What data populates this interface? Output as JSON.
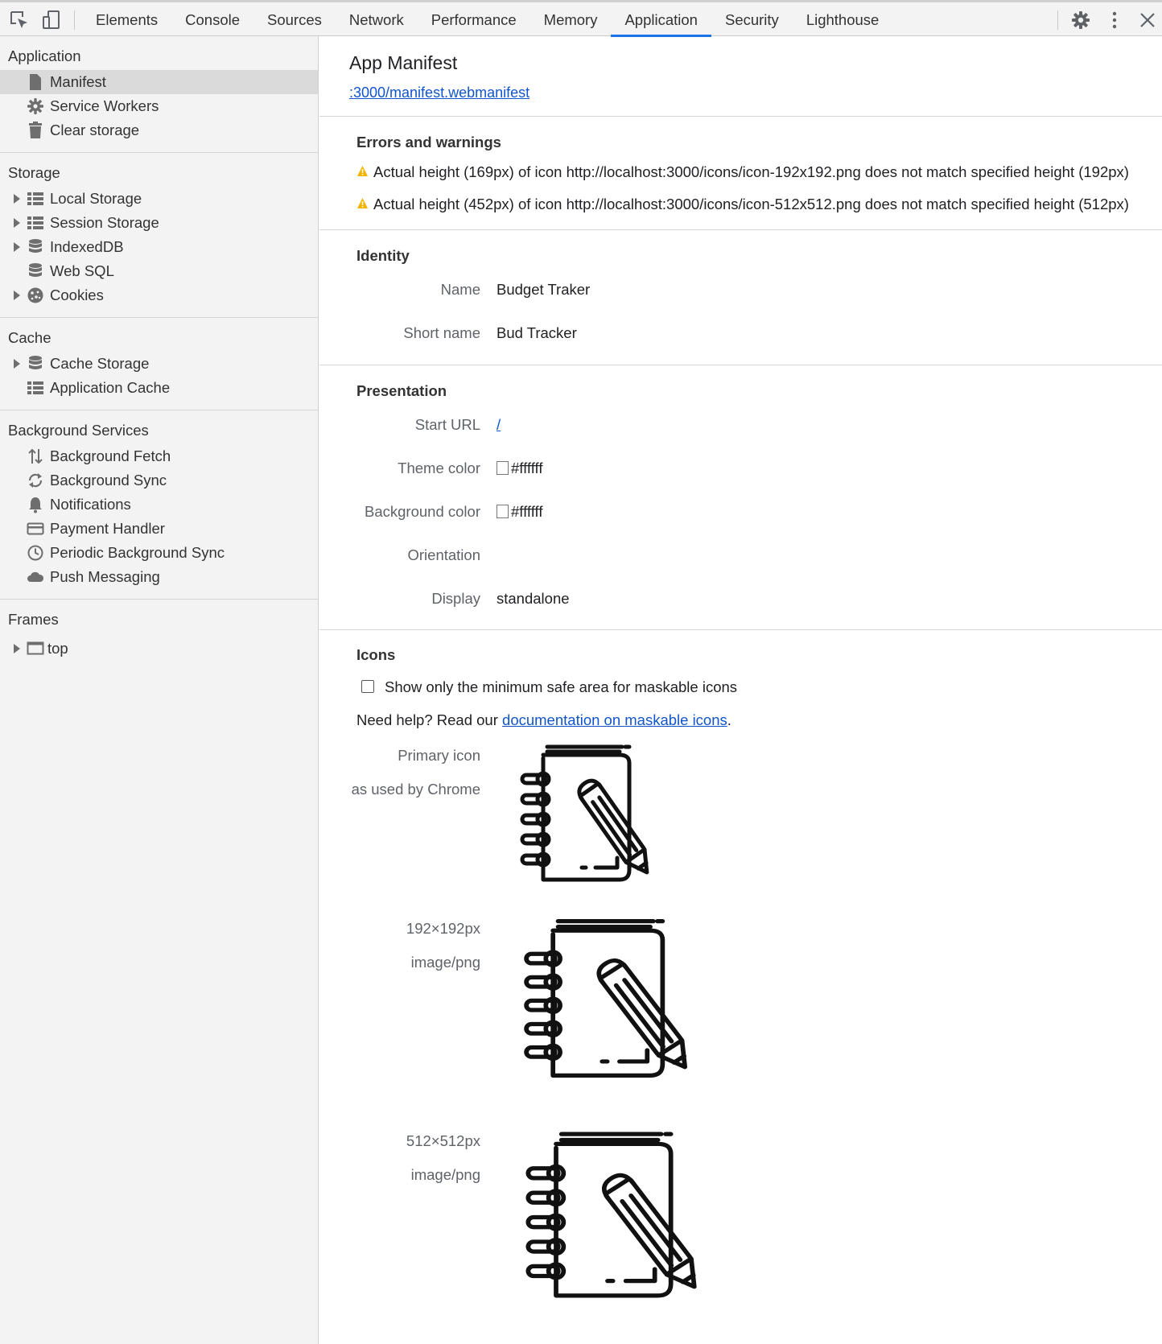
{
  "toolbar": {
    "tabs": [
      "Elements",
      "Console",
      "Sources",
      "Network",
      "Performance",
      "Memory",
      "Application",
      "Security",
      "Lighthouse"
    ],
    "active_tab": "Application"
  },
  "sidebar": {
    "application": {
      "heading": "Application",
      "items": [
        {
          "label": "Manifest",
          "icon": "document-icon"
        },
        {
          "label": "Service Workers",
          "icon": "gear-icon"
        },
        {
          "label": "Clear storage",
          "icon": "trash-icon"
        }
      ]
    },
    "storage": {
      "heading": "Storage",
      "items": [
        {
          "label": "Local Storage",
          "icon": "grid-icon"
        },
        {
          "label": "Session Storage",
          "icon": "grid-icon"
        },
        {
          "label": "IndexedDB",
          "icon": "database-icon"
        },
        {
          "label": "Web SQL",
          "icon": "database-icon"
        },
        {
          "label": "Cookies",
          "icon": "cookie-icon"
        }
      ]
    },
    "cache": {
      "heading": "Cache",
      "items": [
        {
          "label": "Cache Storage",
          "icon": "database-icon"
        },
        {
          "label": "Application Cache",
          "icon": "grid-icon"
        }
      ]
    },
    "background": {
      "heading": "Background Services",
      "items": [
        {
          "label": "Background Fetch",
          "icon": "arrows-updown-icon"
        },
        {
          "label": "Background Sync",
          "icon": "sync-icon"
        },
        {
          "label": "Notifications",
          "icon": "bell-icon"
        },
        {
          "label": "Payment Handler",
          "icon": "card-icon"
        },
        {
          "label": "Periodic Background Sync",
          "icon": "clock-icon"
        },
        {
          "label": "Push Messaging",
          "icon": "cloud-icon"
        }
      ]
    },
    "frames": {
      "heading": "Frames",
      "items": [
        {
          "label": "top",
          "icon": "frame-icon"
        }
      ]
    }
  },
  "main": {
    "title": "App Manifest",
    "manifest_link": ":3000/manifest.webmanifest",
    "errors": {
      "title": "Errors and warnings",
      "warnings": [
        "Actual height (169px) of icon http://localhost:3000/icons/icon-192x192.png does not match specified height (192px)",
        "Actual height (452px) of icon http://localhost:3000/icons/icon-512x512.png does not match specified height (512px)"
      ]
    },
    "identity": {
      "title": "Identity",
      "name_label": "Name",
      "name_value": "Budget Traker",
      "short_name_label": "Short name",
      "short_name_value": "Bud Tracker"
    },
    "presentation": {
      "title": "Presentation",
      "start_url_label": "Start URL",
      "start_url_value": "/",
      "theme_color_label": "Theme color",
      "theme_color_value": "#ffffff",
      "background_color_label": "Background color",
      "background_color_value": "#ffffff",
      "orientation_label": "Orientation",
      "orientation_value": "",
      "display_label": "Display",
      "display_value": "standalone"
    },
    "icons": {
      "title": "Icons",
      "checkbox_label": "Show only the minimum safe area for maskable icons",
      "checkbox_checked": false,
      "help_prefix": "Need help? Read our ",
      "help_link": "documentation on maskable icons",
      "help_suffix": ".",
      "primary_label": "Primary icon",
      "primary_sub": "as used by Chrome",
      "icon1_size": "192×192px",
      "icon1_type": "image/png",
      "icon2_size": "512×512px",
      "icon2_type": "image/png"
    }
  },
  "colors": {
    "accent": "#1a73e8",
    "link": "#1155cc",
    "warning": "#f4b400",
    "sidebar_bg": "#f3f3f3",
    "selected_bg": "#dadada"
  }
}
